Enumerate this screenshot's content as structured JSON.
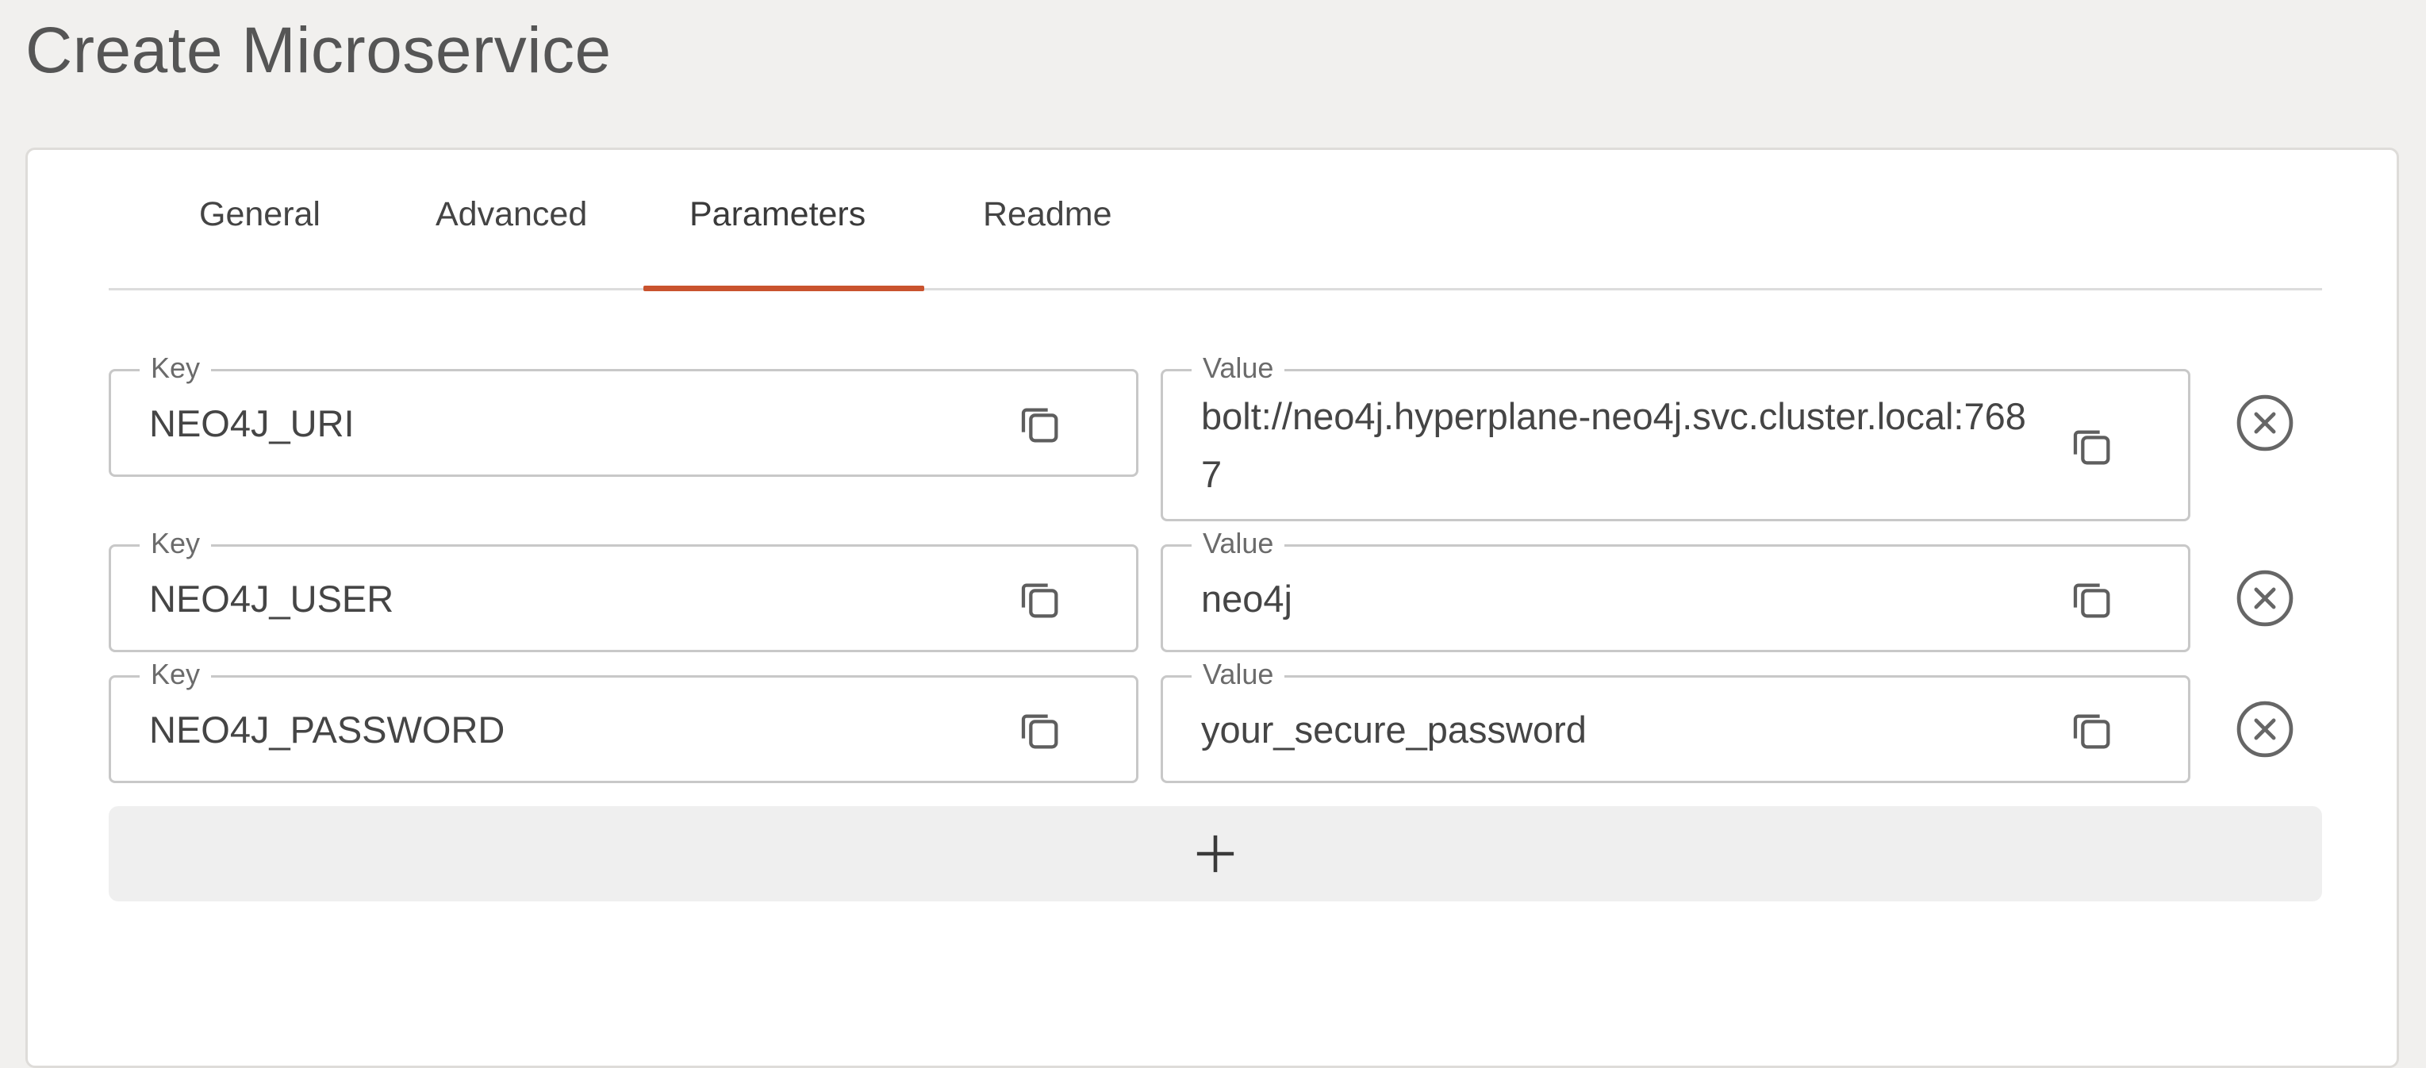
{
  "page": {
    "title": "Create Microservice"
  },
  "tabs": [
    {
      "label": "General",
      "active": false
    },
    {
      "label": "Advanced",
      "active": false
    },
    {
      "label": "Parameters",
      "active": true
    },
    {
      "label": "Readme",
      "active": false
    }
  ],
  "parameters": [
    {
      "key_label": "Key",
      "key": "NEO4J_URI",
      "value_label": "Value",
      "value": "bolt://neo4j.hyperplane-neo4j.svc.cluster.local:7687"
    },
    {
      "key_label": "Key",
      "key": "NEO4J_USER",
      "value_label": "Value",
      "value": "neo4j"
    },
    {
      "key_label": "Key",
      "key": "NEO4J_PASSWORD",
      "value_label": "Value",
      "value": "your_secure_password"
    }
  ],
  "icons": {
    "copy": "copy-icon",
    "remove": "close-circle-icon",
    "add": "plus-icon"
  },
  "colors": {
    "accent": "#c9532e",
    "background": "#f1f0ee",
    "card": "#ffffff",
    "field_border": "#c8c8c8",
    "add_bar": "#efefef"
  }
}
